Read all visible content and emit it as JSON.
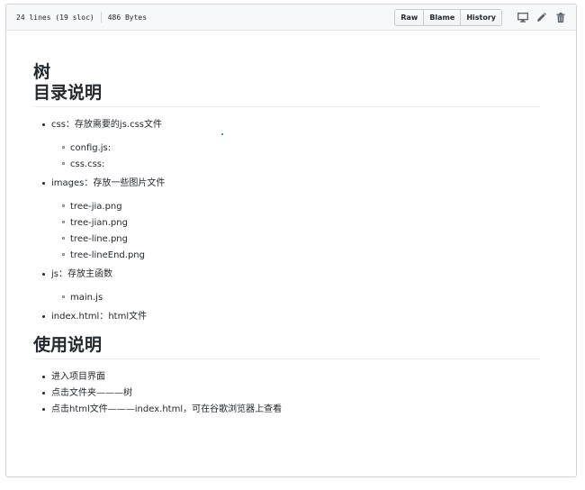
{
  "file_header": {
    "lines": "24 lines (19 sloc)",
    "size": "486 Bytes",
    "buttons": {
      "raw": "Raw",
      "blame": "Blame",
      "history": "History"
    }
  },
  "readme": {
    "title": "树",
    "section1": {
      "heading": "目录说明",
      "items": [
        {
          "label": "css：存放需要的js.css文件",
          "children": [
            "config.js:",
            "css.css:"
          ]
        },
        {
          "label": "images：存放一些图片文件",
          "children": [
            "tree-jia.png",
            "tree-jian.png",
            "tree-line.png",
            "tree-lineEnd.png"
          ]
        },
        {
          "label": "js：存放主函数",
          "children": [
            "main.js"
          ]
        },
        {
          "label": "index.html：html文件",
          "children": []
        }
      ]
    },
    "section2": {
      "heading": "使用说明",
      "items": [
        "进入项目界面",
        "点击文件夹———树",
        "点击html文件———index.html，可在谷歌浏览器上查看"
      ]
    }
  },
  "icons": [
    "desktop-icon",
    "pencil-icon",
    "trash-icon"
  ]
}
